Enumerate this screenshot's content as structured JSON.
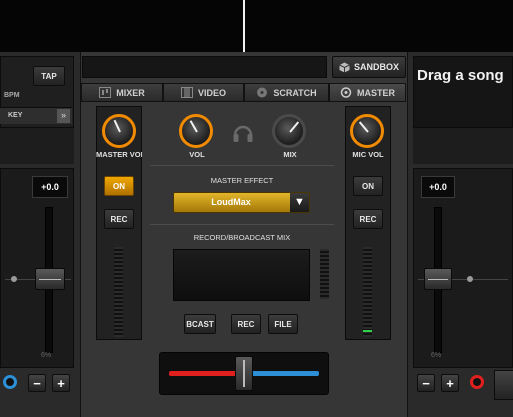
{
  "left_deck": {
    "tap_label": "TAP",
    "bpm_label": "BPM",
    "key_label": "KEY",
    "pitch_value": "+0.0",
    "pitch_range": "6%",
    "minus_label": "−",
    "plus_label": "+"
  },
  "right_deck": {
    "drop_text": "Drag a song",
    "pitch_value": "+0.0",
    "pitch_range": "6%",
    "minus_label": "−",
    "plus_label": "+"
  },
  "toolbar": {
    "sandbox_label": "SANDBOX"
  },
  "tabs": [
    {
      "label": "MIXER",
      "icon": "mixer-icon"
    },
    {
      "label": "VIDEO",
      "icon": "film-icon"
    },
    {
      "label": "SCRATCH",
      "icon": "vinyl-icon"
    },
    {
      "label": "MASTER",
      "icon": "target-icon"
    }
  ],
  "master": {
    "left_knob_label": "MASTER VOL",
    "vol_label": "VOL",
    "mix_label": "MIX",
    "mic_vol_label": "MIC VOL",
    "headphones_icon": "headphones-icon",
    "on_left_label": "ON",
    "on_right_label": "ON",
    "rec_left_label": "REC",
    "rec_right_label": "REC",
    "effect_title": "MASTER EFFECT",
    "effect_value": "LoudMax",
    "record_title": "RECORD/BROADCAST MIX",
    "bcast_label": "BCAST",
    "rec_label": "REC",
    "file_label": "FILE"
  },
  "colors": {
    "accent": "#f08a00",
    "crossfader_left": "#e0201c",
    "crossfader_right": "#2d8fd6",
    "effect_select": "#c89a10"
  }
}
